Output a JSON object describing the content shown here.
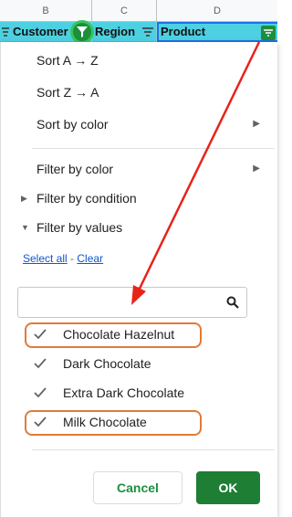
{
  "columns": {
    "letters": [
      "B",
      "C",
      "D"
    ]
  },
  "header_row": {
    "customer": "Customer",
    "region": "Region",
    "product": "Product"
  },
  "menu": {
    "sort_az": "Sort A → Z",
    "sort_za": "Sort Z → A",
    "sort_by_color": "Sort by color",
    "filter_by_color": "Filter by color",
    "filter_by_condition": "Filter by condition",
    "filter_by_values": "Filter by values",
    "select_all": "Select all",
    "separator": " - ",
    "clear": "Clear",
    "search_value": ""
  },
  "values": [
    {
      "label": "Chocolate Hazelnut",
      "checked": true,
      "highlighted": true
    },
    {
      "label": "Dark Chocolate",
      "checked": true,
      "highlighted": false
    },
    {
      "label": "Extra Dark Chocolate",
      "checked": true,
      "highlighted": false
    },
    {
      "label": "Milk Chocolate",
      "checked": true,
      "highlighted": true
    }
  ],
  "buttons": {
    "cancel": "Cancel",
    "ok": "OK"
  },
  "colors": {
    "header_fill": "#4dd0e1",
    "accent_green": "#1e8e3e",
    "annotation_red": "#e8231a",
    "annotation_orange": "#e07b39"
  }
}
